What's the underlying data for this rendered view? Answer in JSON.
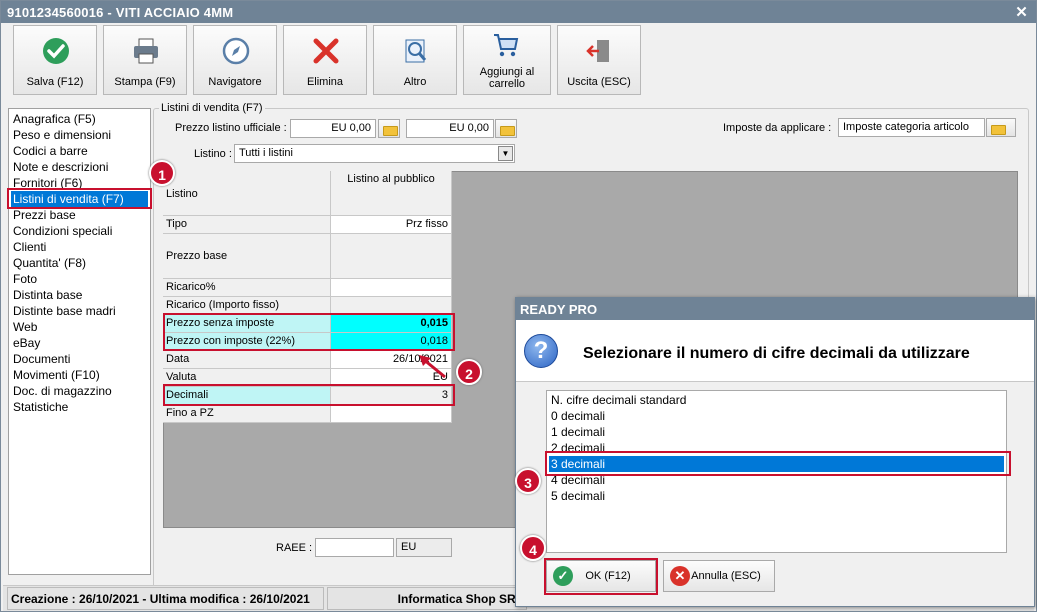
{
  "window": {
    "title": "9101234560016 - VITI ACCIAIO 4MM",
    "close_glyph": "✕"
  },
  "toolbar": {
    "buttons": [
      {
        "label": "Salva (F12)",
        "icon": "check-circle-icon"
      },
      {
        "label": "Stampa (F9)",
        "icon": "printer-icon"
      },
      {
        "label": "Navigatore",
        "icon": "compass-icon"
      },
      {
        "label": "Elimina",
        "icon": "red-x-icon"
      },
      {
        "label": "Altro",
        "icon": "magnifier-document-icon"
      },
      {
        "label": "Aggiungi al carrello",
        "icon": "cart-icon"
      },
      {
        "label": "Uscita (ESC)",
        "icon": "exit-door-icon"
      }
    ]
  },
  "sidebar": {
    "items": [
      "Anagrafica (F5)",
      "Peso e dimensioni",
      "Codici a barre",
      "Note e descrizioni",
      "Fornitori (F6)",
      "Listini di vendita (F7)",
      "Prezzi base",
      "Condizioni speciali",
      "Clienti",
      "Quantita' (F8)",
      "Foto",
      "Distinta base",
      "Distinte base madri",
      "Web",
      "eBay",
      "Documenti",
      "Movimenti (F10)",
      "Doc. di magazzino",
      "Statistiche"
    ],
    "selected_index": 5
  },
  "listini": {
    "group_title": "Listini di vendita (F7)",
    "prezzo_label": "Prezzo listino ufficiale :",
    "prezzo_value_1": "EU 0,00",
    "prezzo_value_2": "EU 0,00",
    "imposte_label": "Imposte da applicare :",
    "imposte_value": "Imposte categoria articolo",
    "listino_label": "Listino :",
    "listino_value": "Tutti i listini",
    "grid": {
      "header_col1": "Listino",
      "header_col2": "Listino al pubblico",
      "rows": [
        {
          "label": "Tipo",
          "value": "Prz fisso"
        },
        {
          "label": "Prezzo base",
          "value": ""
        },
        {
          "label": "Ricarico%",
          "value": ""
        },
        {
          "label": "Ricarico (Importo fisso)",
          "value": ""
        },
        {
          "label": "Prezzo senza imposte",
          "value": "0,015"
        },
        {
          "label": "Prezzo con imposte (22%)",
          "value": "0,018"
        },
        {
          "label": "Data",
          "value": "26/10/2021"
        },
        {
          "label": "Valuta",
          "value": "EU"
        },
        {
          "label": "Decimali",
          "value": "3"
        },
        {
          "label": "Fino a PZ",
          "value": ""
        }
      ]
    },
    "raee_label": "RAEE :",
    "raee_value": "",
    "raee_currency": "EU"
  },
  "status": {
    "left": "Creazione : 26/10/2021 - Ultima modifica : 26/10/2021",
    "right": "Informatica Shop SRL"
  },
  "dialog": {
    "title": "READY PRO",
    "message": "Selezionare il numero di cifre decimali da utilizzare",
    "icon": "question-icon",
    "options": [
      "N. cifre decimali standard",
      "0 decimali",
      "1 decimali",
      "2 decimali",
      "3 decimali",
      "4 decimali",
      "5 decimali"
    ],
    "selected_index": 4,
    "ok_label": "OK (F12)",
    "cancel_label": "Annulla (ESC)"
  },
  "annotations": {
    "badges": [
      "1",
      "2",
      "3",
      "4"
    ],
    "color": "#c8102e"
  }
}
